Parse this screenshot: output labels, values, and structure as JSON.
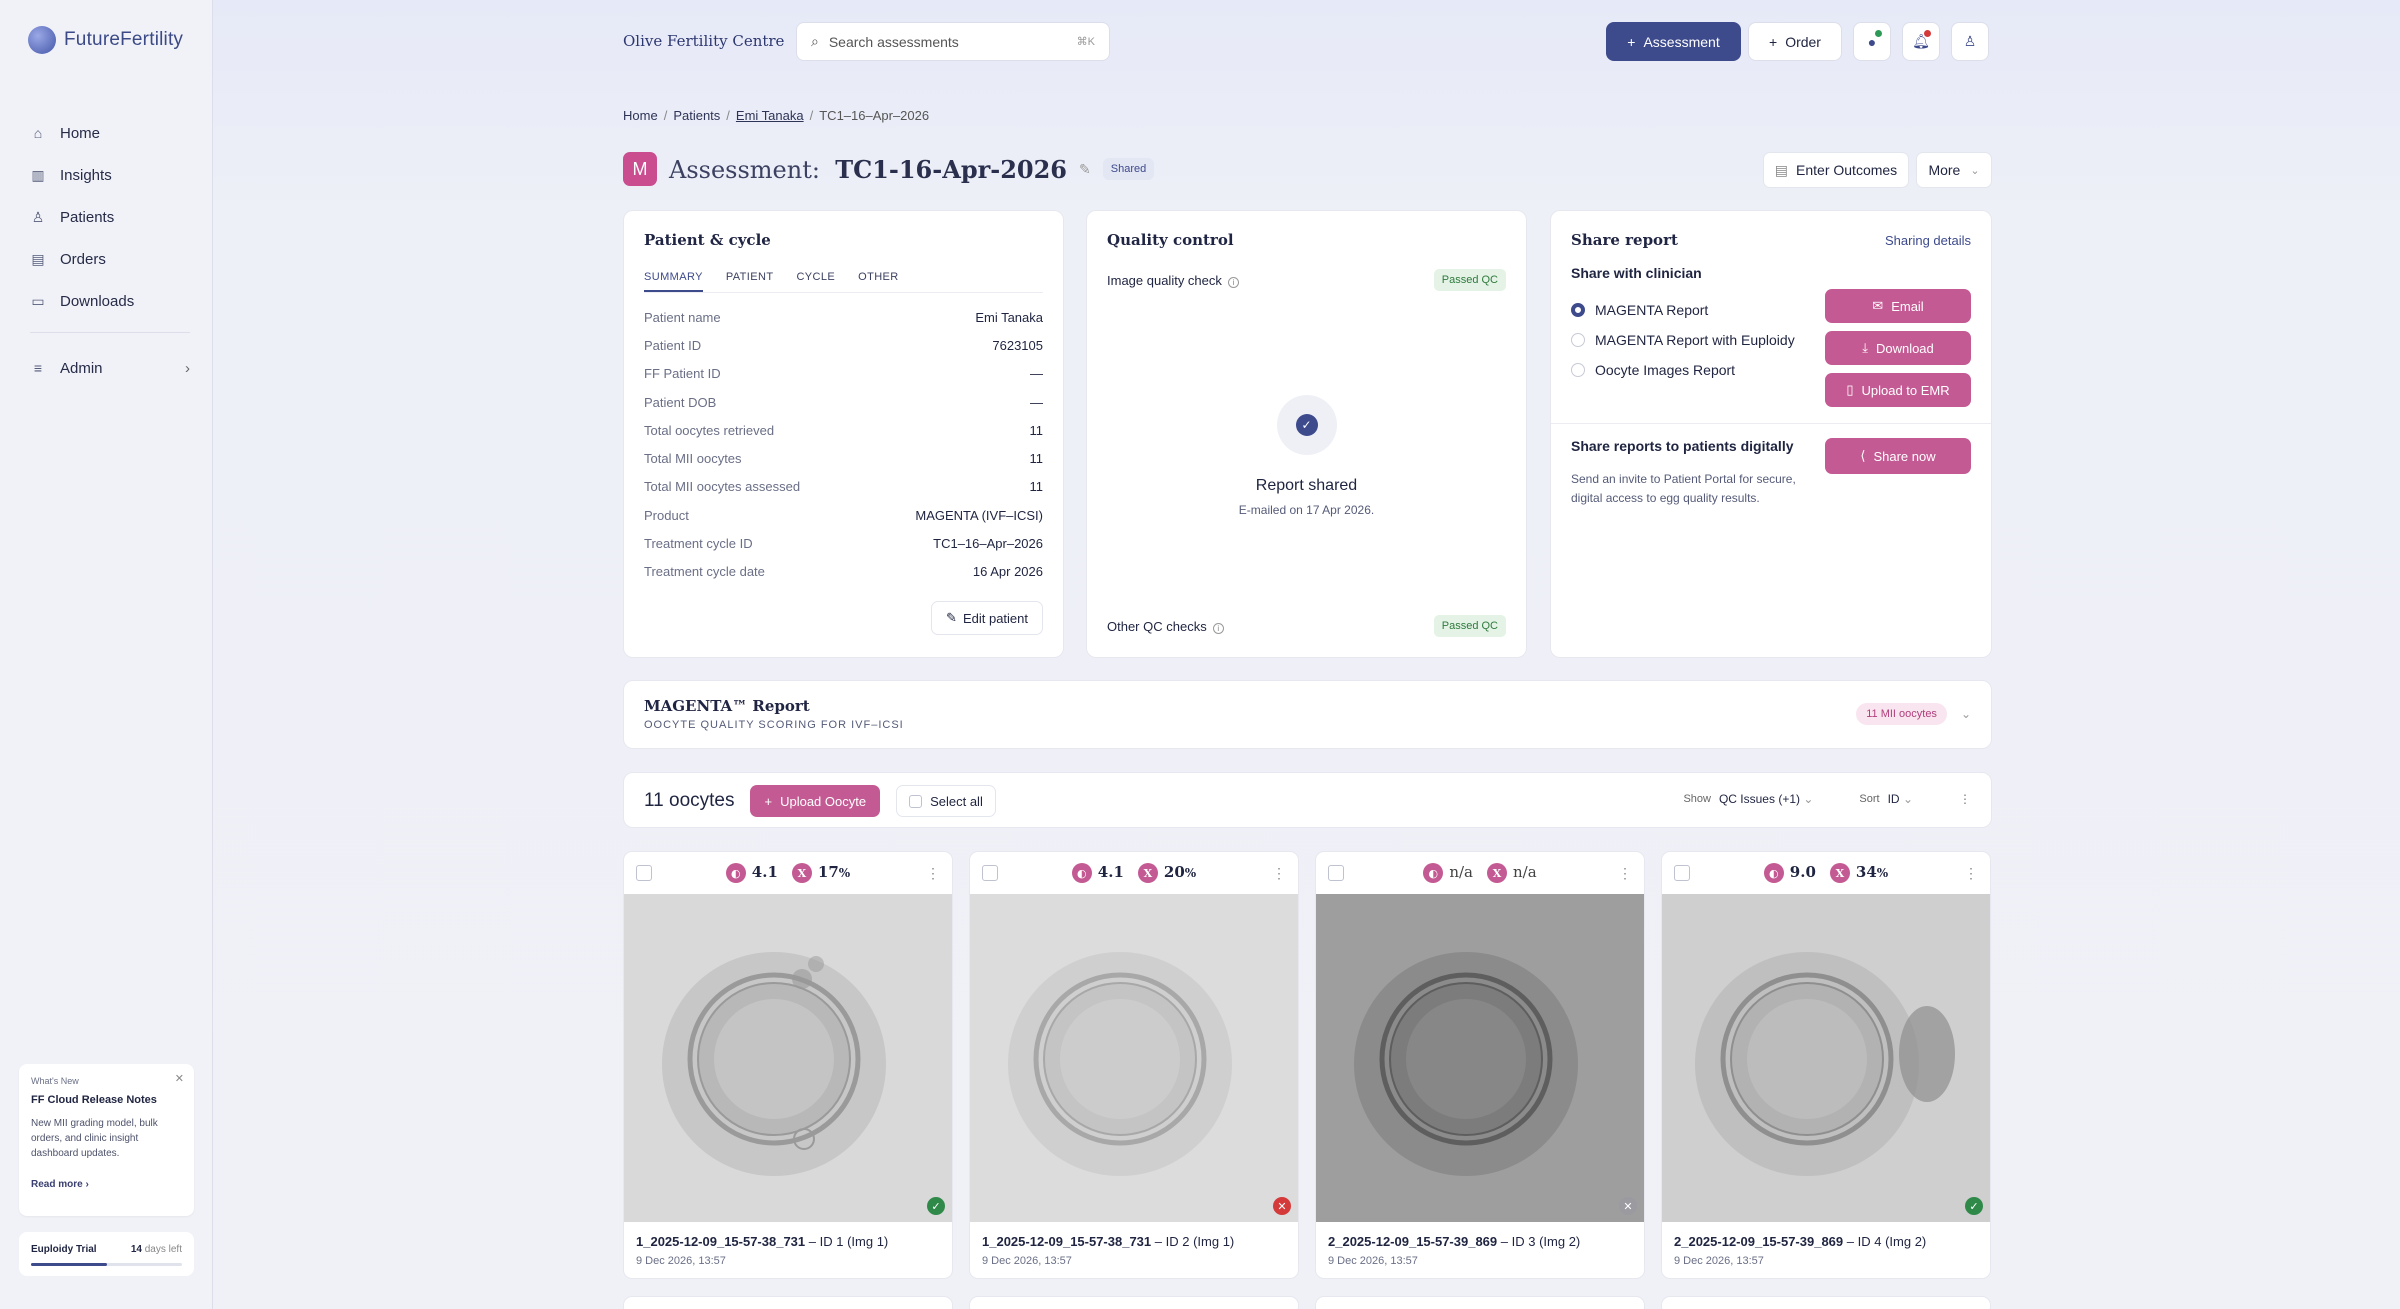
{
  "app": {
    "name": "FutureFertility"
  },
  "sidebar": {
    "items": [
      {
        "label": "Home",
        "icon": "home-icon"
      },
      {
        "label": "Insights",
        "icon": "chart-icon"
      },
      {
        "label": "Patients",
        "icon": "user-icon"
      },
      {
        "label": "Orders",
        "icon": "clipboard-icon"
      },
      {
        "label": "Downloads",
        "icon": "folder-icon"
      }
    ],
    "admin": {
      "label": "Admin"
    },
    "whats_new": {
      "kicker": "What's New",
      "title": "FF Cloud Release Notes",
      "body": "New MII grading model, bulk orders, and clinic insight dashboard updates.",
      "link": "Read more ›"
    },
    "trial": {
      "label": "Euploidy Trial",
      "days": "14",
      "days_suffix": "days left",
      "progress": 0.5
    }
  },
  "header": {
    "clinic": "Olive Fertility Centre",
    "search_placeholder": "Search assessments",
    "search_shortcut": "⌘K",
    "assessment_btn": "Assessment",
    "order_btn": "Order"
  },
  "breadcrumb": {
    "home": "Home",
    "patients": "Patients",
    "patient": "Emi Tanaka",
    "current": "TC1–16–Apr–2026"
  },
  "page": {
    "badge_letter": "M",
    "title_label": "Assessment:",
    "title_value": "TC1-16-Apr-2026",
    "status": "Shared",
    "enter_outcomes": "Enter Outcomes",
    "more": "More"
  },
  "patient_card": {
    "title": "Patient & cycle",
    "tabs": [
      "SUMMARY",
      "PATIENT",
      "CYCLE",
      "OTHER"
    ],
    "rows": [
      {
        "k": "Patient name",
        "v": "Emi Tanaka"
      },
      {
        "k": "Patient ID",
        "v": "7623105"
      },
      {
        "k": "FF Patient ID",
        "v": "—"
      },
      {
        "k": "Patient DOB",
        "v": "—"
      },
      {
        "k": "Total oocytes retrieved",
        "v": "11"
      },
      {
        "k": "Total MII oocytes",
        "v": "11"
      },
      {
        "k": "Total MII oocytes assessed",
        "v": "11"
      },
      {
        "k": "Product",
        "v": "MAGENTA (IVF–ICSI)"
      },
      {
        "k": "Treatment cycle ID",
        "v": "TC1–16–Apr–2026"
      },
      {
        "k": "Treatment cycle date",
        "v": "16 Apr 2026"
      }
    ],
    "edit_btn": "Edit patient"
  },
  "qc_card": {
    "title": "Quality control",
    "image_check": "Image quality check",
    "image_status": "Passed QC",
    "shared_title": "Report shared",
    "shared_sub": "E-mailed on 17 Apr 2026.",
    "other_check": "Other QC checks",
    "other_status": "Passed QC"
  },
  "share_card": {
    "title": "Share report",
    "details_link": "Sharing details",
    "clinician_heading": "Share with clinician",
    "options": [
      "MAGENTA Report",
      "MAGENTA Report with Euploidy",
      "Oocyte Images Report"
    ],
    "selected": 0,
    "buttons": {
      "email": "Email",
      "download": "Download",
      "emr": "Upload to EMR"
    },
    "patients_heading": "Share reports to patients digitally",
    "patients_body": "Send an invite to Patient Portal for secure, digital access to egg quality results.",
    "share_now": "Share now"
  },
  "report_section": {
    "title": "MAGENTA™ Report",
    "subtitle": "OOCYTE QUALITY SCORING FOR IVF–ICSI",
    "badge": "11 MII oocytes"
  },
  "oocyte_toolbar": {
    "count": "11 oocytes",
    "upload": "Upload Oocyte",
    "select_all": "Select all",
    "show_label": "Show",
    "show_value": "QC Issues (+1)",
    "sort_label": "Sort",
    "sort_value": "ID"
  },
  "oocytes": [
    {
      "score": "4.1",
      "pct": "17",
      "file": "1_2025-12-09_15-57-38_731",
      "suffix": "– ID 1 (Img 1)",
      "date": "9 Dec 2026, 13:57",
      "status": "ok",
      "status_color": "#2f8a4a"
    },
    {
      "score": "4.1",
      "pct": "20",
      "file": "1_2025-12-09_15-57-38_731",
      "suffix": "– ID 2 (Img 1)",
      "date": "9 Dec 2026, 13:57",
      "status": "fail",
      "status_color": "#d43a3a"
    },
    {
      "score": "n/a",
      "pct": "n/a",
      "file": "2_2025-12-09_15-57-39_869",
      "suffix": "– ID 3 (Img 2)",
      "date": "9 Dec 2026, 13:57",
      "status": "na",
      "status_color": "#9a9aa0"
    },
    {
      "score": "9.0",
      "pct": "34",
      "file": "2_2025-12-09_15-57-39_869",
      "suffix": "– ID 4 (Img 2)",
      "date": "9 Dec 2026, 13:57",
      "status": "ok",
      "status_color": "#2f8a4a"
    }
  ],
  "colors": {
    "primary": "#3d4a8c",
    "accent": "#c45a93",
    "success": "#2f7a3d"
  }
}
